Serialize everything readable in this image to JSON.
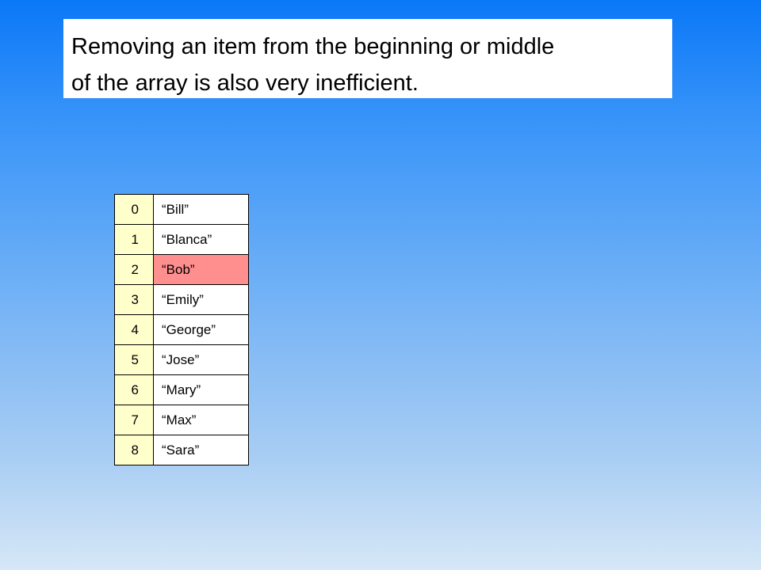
{
  "caption": {
    "line1": "Removing an item from the beginning or middle",
    "line2": "of the array is also very inefficient."
  },
  "array": {
    "highlight_color": "#ff8f8f",
    "index_cell_color": "#ffffcc",
    "rows": [
      {
        "index": "0",
        "value": "“Bill”",
        "highlighted": false
      },
      {
        "index": "1",
        "value": "“Blanca”",
        "highlighted": false
      },
      {
        "index": "2",
        "value": "“Bob”",
        "highlighted": true
      },
      {
        "index": "3",
        "value": "“Emily”",
        "highlighted": false
      },
      {
        "index": "4",
        "value": "“George”",
        "highlighted": false
      },
      {
        "index": "5",
        "value": "“Jose”",
        "highlighted": false
      },
      {
        "index": "6",
        "value": "“Mary”",
        "highlighted": false
      },
      {
        "index": "7",
        "value": "“Max”",
        "highlighted": false
      },
      {
        "index": "8",
        "value": "“Sara”",
        "highlighted": false
      }
    ]
  }
}
